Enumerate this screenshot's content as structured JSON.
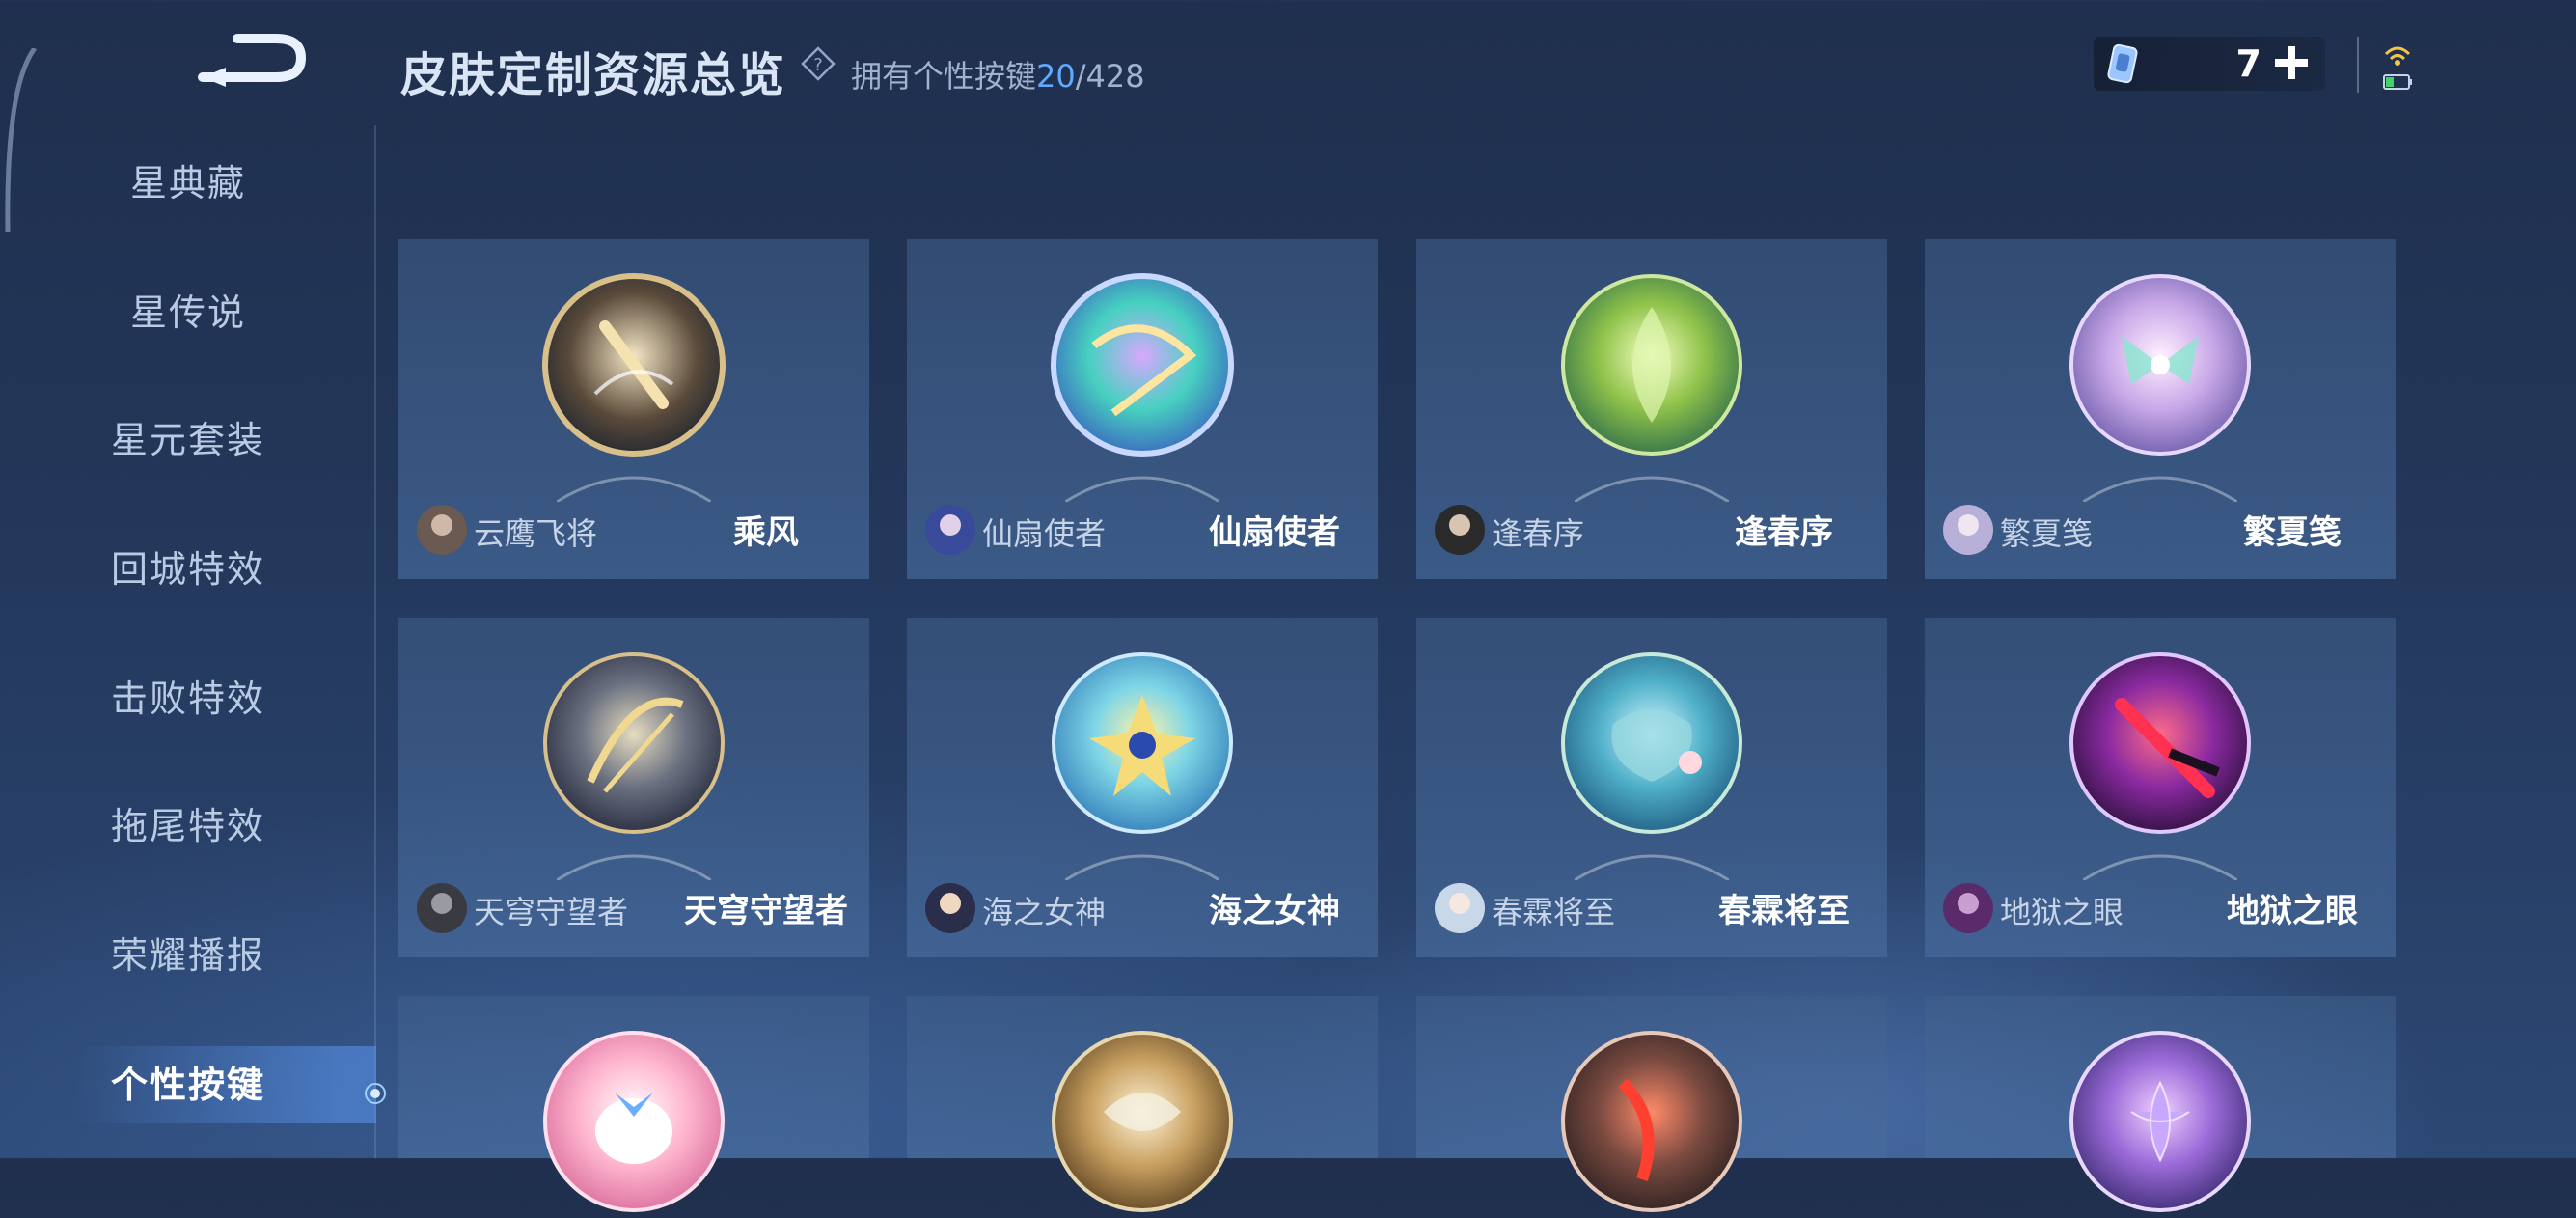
{
  "header": {
    "title": "皮肤定制资源总览",
    "owned_label": "拥有个性按键",
    "owned_count": "20",
    "owned_total": "/428"
  },
  "currency": {
    "count": "7"
  },
  "sidebar": {
    "items": [
      {
        "label": "星典藏"
      },
      {
        "label": "星传说"
      },
      {
        "label": "星元套装"
      },
      {
        "label": "回城特效"
      },
      {
        "label": "击败特效"
      },
      {
        "label": "拖尾特效"
      },
      {
        "label": "荣耀播报"
      },
      {
        "label": "个性按键",
        "active": true
      }
    ]
  },
  "cards": [
    {
      "hero": "云鹰飞将",
      "skin": "乘风"
    },
    {
      "hero": "仙扇使者",
      "skin": "仙扇使者"
    },
    {
      "hero": "逢春序",
      "skin": "逢春序"
    },
    {
      "hero": "繁夏笺",
      "skin": "繁夏笺"
    },
    {
      "hero": "天穹守望者",
      "skin": "天穹守望者"
    },
    {
      "hero": "海之女神",
      "skin": "海之女神"
    },
    {
      "hero": "春霖将至",
      "skin": "春霖将至"
    },
    {
      "hero": "地狱之眼",
      "skin": "地狱之眼"
    }
  ],
  "colors": {
    "accent": "#5fa9ff",
    "active_glow": "#5a96f0"
  }
}
